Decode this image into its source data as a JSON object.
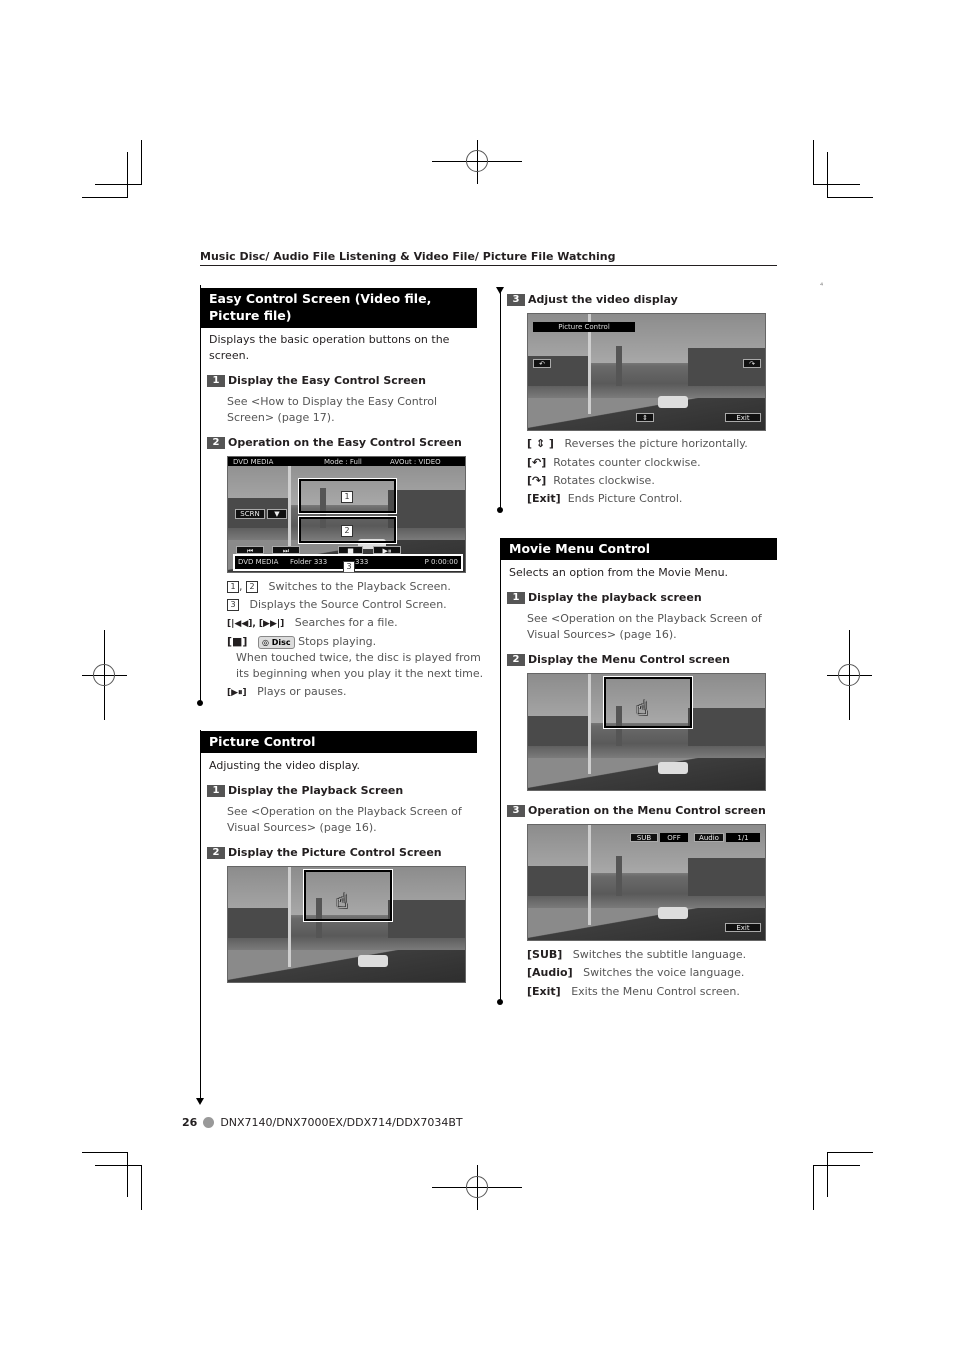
{
  "running_head": "Music Disc/ Audio File Listening & Video File/ Picture File Watching",
  "margin_mark": "⁴",
  "easy_control": {
    "title": "Easy Control Screen (Video file, Picture file)",
    "intro": "Displays the basic operation buttons on the screen.",
    "steps": [
      {
        "num": "1",
        "title": "Display the Easy Control Screen",
        "text": "See <How to Display the Easy Control Screen> (page 17)."
      },
      {
        "num": "2",
        "title": "Operation on the Easy Control Screen"
      }
    ],
    "screen": {
      "top_left": "DVD MEDIA",
      "top_mode": "Mode : Full",
      "top_avout": "AVOut : VIDEO",
      "scrn_button": "SCRN",
      "scrn_arrow": "▼",
      "prev_button": "⏮",
      "next_button": "⏭",
      "stop_button": "■",
      "play_pause_button": "▶⏸",
      "bottom_source": "DVD MEDIA",
      "bottom_folder": "Folder 333",
      "bottom_file": "333",
      "bottom_time": "P   0:00:00",
      "area_labels": [
        "1",
        "2",
        "3"
      ]
    },
    "descriptions": [
      {
        "keys": "1, 2",
        "text": "Switches to the Playback Screen."
      },
      {
        "keys": "3",
        "text": "Displays the Source Control Screen."
      },
      {
        "keys": "[|◀◀], [▶▶|]",
        "text": "Searches for a file."
      },
      {
        "keys": "[■]",
        "badge": "Disc",
        "text": "Stops playing."
      },
      {
        "text": "When touched twice, the disc is played from"
      },
      {
        "text": "its beginning when you play it the next time."
      },
      {
        "keys": "[▶⏸]",
        "text": "Plays or pauses."
      }
    ]
  },
  "picture_control": {
    "title": "Picture Control",
    "intro": "Adjusting the video display.",
    "steps": [
      {
        "num": "1",
        "title": "Display the Playback Screen",
        "text": "See <Operation on the Playback Screen of Visual Sources> (page 16)."
      },
      {
        "num": "2",
        "title": "Display the Picture Control Screen"
      },
      {
        "num": "3",
        "title": "Adjust the video display"
      }
    ],
    "screen": {
      "label": "Picture Control",
      "rotate_ccw": "↶",
      "rotate_cw": "↷",
      "flip": "⇕",
      "exit": "Exit"
    },
    "descriptions": [
      {
        "keys": "[ ⇕ ]",
        "text": "Reverses the picture horizontally."
      },
      {
        "keys": "[↶]",
        "text": "Rotates counter clockwise."
      },
      {
        "keys": "[↷]",
        "text": "Rotates clockwise."
      },
      {
        "keys": "[Exit]",
        "text": "Ends Picture Control."
      }
    ]
  },
  "movie_menu": {
    "title": "Movie Menu Control",
    "intro": "Selects an option from the Movie Menu.",
    "steps": [
      {
        "num": "1",
        "title": "Display the playback screen",
        "text": "See <Operation on the Playback Screen of Visual Sources> (page 16)."
      },
      {
        "num": "2",
        "title": "Display the Menu Control screen"
      },
      {
        "num": "3",
        "title": "Operation on the Menu Control screen"
      }
    ],
    "screen": {
      "sub_label": "SUB",
      "sub_value": "OFF",
      "audio_label": "Audio",
      "audio_value": "1/1",
      "exit": "Exit"
    },
    "descriptions": [
      {
        "keys": "[SUB]",
        "text": "Switches the subtitle language."
      },
      {
        "keys": "[Audio]",
        "text": "Switches the voice language."
      },
      {
        "keys": "[Exit]",
        "text": "Exits the Menu Control screen."
      }
    ]
  },
  "footer": {
    "page_number": "26",
    "models": "DNX7140/DNX7000EX/DDX714/DDX7034BT"
  }
}
